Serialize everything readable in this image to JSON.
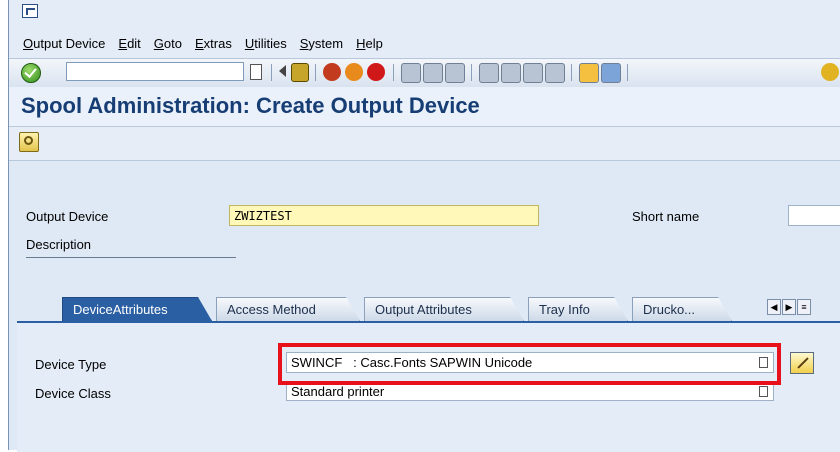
{
  "menu": {
    "items": [
      "Output Device",
      "Edit",
      "Goto",
      "Extras",
      "Utilities",
      "System",
      "Help"
    ]
  },
  "toolbar": {
    "command_value": "",
    "icons": [
      "check-icon",
      "f4-help-icon",
      "back-arrow-icon",
      "save-icon",
      "back-icon",
      "exit-icon",
      "cancel-icon",
      "print-icon",
      "find-icon",
      "find-next-icon",
      "first-page-icon",
      "prev-page-icon",
      "next-page-icon",
      "last-page-icon",
      "create-session-icon",
      "shortcut-icon",
      "help-icon"
    ]
  },
  "title": "Spool Administration: Create Output Device",
  "form": {
    "output_device_label": "Output Device",
    "output_device_value": "ZWIZTEST",
    "short_name_label": "Short name",
    "short_name_value": "",
    "description_label": "Description",
    "description_value": ""
  },
  "tabs": [
    "DeviceAttributes",
    "Access Method",
    "Output Attributes",
    "Tray Info",
    "Drucko..."
  ],
  "active_tab": "DeviceAttributes",
  "device": {
    "device_type_label": "Device Type",
    "device_type_value": "SWINCF   : Casc.Fonts SAPWIN Unicode",
    "device_class_label": "Device Class",
    "device_class_value": "Standard printer"
  },
  "colors": {
    "highlight": "#e8101a",
    "title": "#173e74",
    "required_field": "#fff8b8",
    "active_tab": "#2b5fa3"
  }
}
